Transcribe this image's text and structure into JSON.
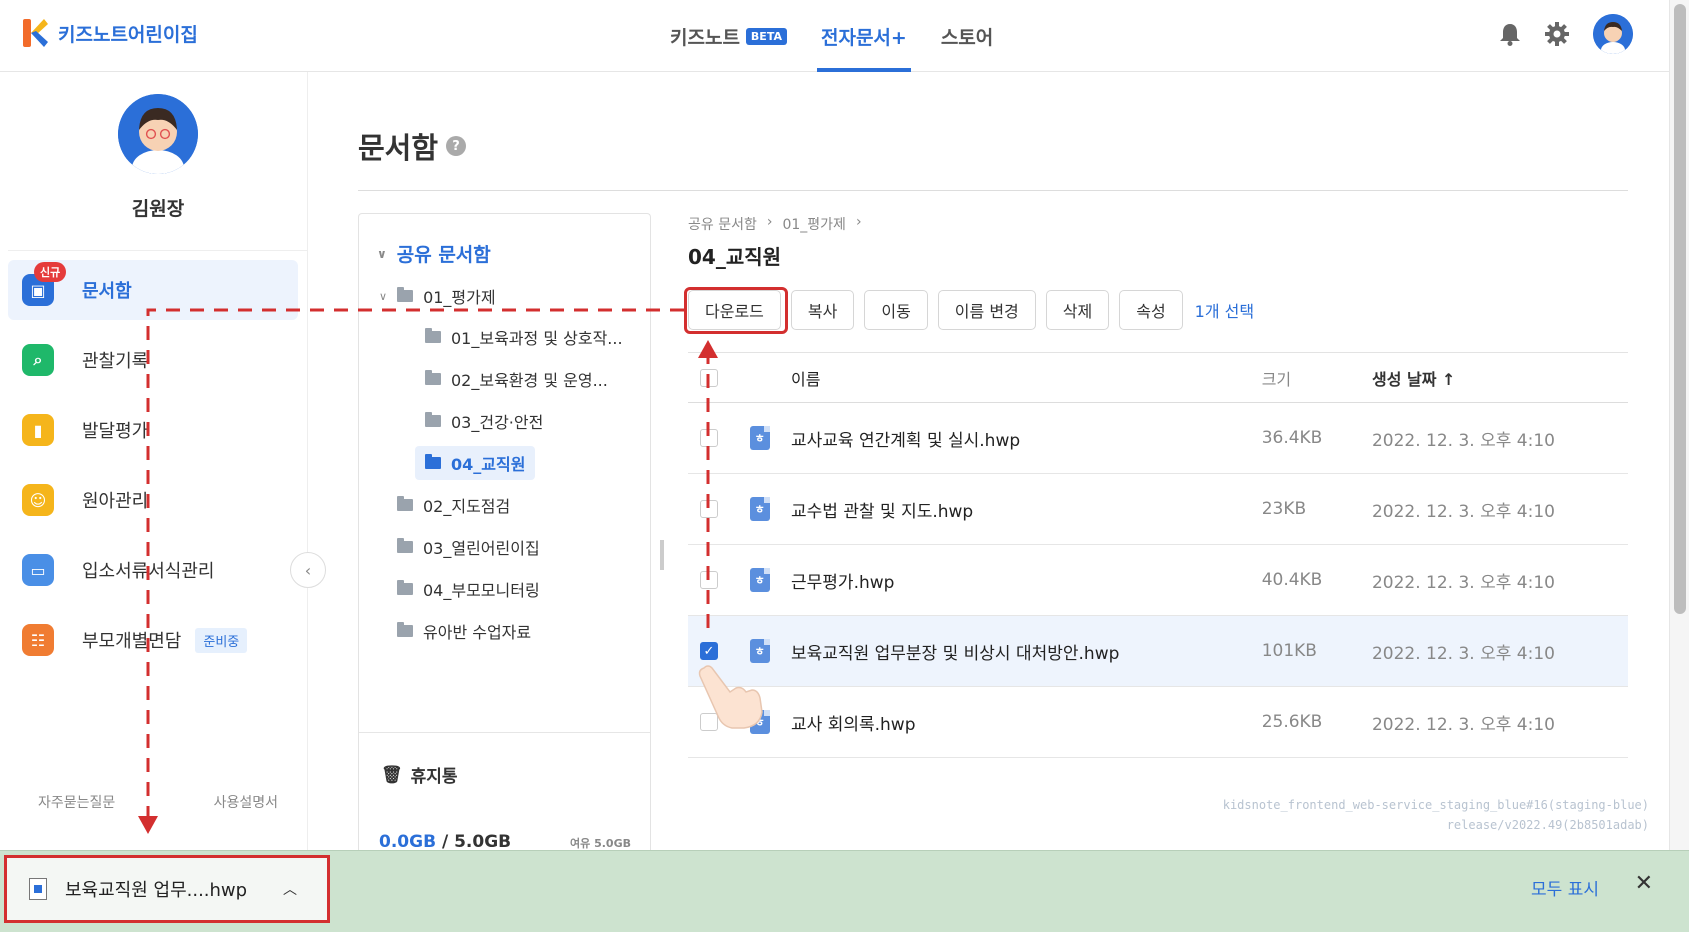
{
  "header": {
    "brand": "키즈노트어린이집",
    "nav": [
      {
        "label": "키즈노트",
        "badge": "BETA"
      },
      {
        "label": "전자문서+"
      },
      {
        "label": "스토어"
      }
    ]
  },
  "sidebar": {
    "user_name": "김원장",
    "new_badge": "신규",
    "items": [
      {
        "label": "문서함",
        "icon": "document-box-icon",
        "color": "#2b6fd8"
      },
      {
        "label": "관찰기록",
        "icon": "magnifier-icon",
        "color": "#1fb86a"
      },
      {
        "label": "발달평가",
        "icon": "bar-chart-icon",
        "color": "#f5b51b"
      },
      {
        "label": "원아관리",
        "icon": "children-icon",
        "color": "#f5b51b"
      },
      {
        "label": "입소서류서식관리",
        "icon": "form-icon",
        "color": "#4a8fe6"
      },
      {
        "label": "부모개별면담",
        "icon": "meeting-icon",
        "color": "#f07c32",
        "badge": "준비중"
      }
    ],
    "footer": {
      "faq": "자주묻는질문",
      "manual": "사용설명서"
    }
  },
  "main": {
    "title": "문서함",
    "tree": {
      "root": "공유 문서함",
      "nodes": [
        {
          "label": "01_평가제",
          "level": 1
        },
        {
          "label": "01_보육과정 및 상호작...",
          "level": 2
        },
        {
          "label": "02_보육환경 및 운영...",
          "level": 2
        },
        {
          "label": "03_건강·안전",
          "level": 2
        },
        {
          "label": "04_교직원",
          "level": 2
        },
        {
          "label": "02_지도점검",
          "level": 1
        },
        {
          "label": "03_열린어린이집",
          "level": 1
        },
        {
          "label": "04_부모모니터링",
          "level": 1
        },
        {
          "label": "유아반 수업자료",
          "level": 1
        }
      ],
      "trash": "휴지통",
      "storage_used": "0.0GB",
      "storage_total": " / 5.0GB",
      "storage_free": "여유 5.0GB"
    },
    "breadcrumb": [
      "공유 문서함",
      "01_평가제"
    ],
    "folder_title": "04_교직원",
    "toolbar": {
      "download": "다운로드",
      "copy": "복사",
      "move": "이동",
      "rename": "이름 변경",
      "delete": "삭제",
      "properties": "속성",
      "selection": "1개 선택"
    },
    "columns": {
      "name": "이름",
      "size": "크기",
      "date": "생성 날짜 ↑"
    },
    "files": [
      {
        "name": "교사교육 연간계획 및 실시.hwp",
        "size": "36.4KB",
        "date": "2022. 12. 3. 오후 4:10",
        "checked": false
      },
      {
        "name": "교수법 관찰 및 지도.hwp",
        "size": "23KB",
        "date": "2022. 12. 3. 오후 4:10",
        "checked": false
      },
      {
        "name": "근무평가.hwp",
        "size": "40.4KB",
        "date": "2022. 12. 3. 오후 4:10",
        "checked": false
      },
      {
        "name": "보육교직원 업무분장 및 비상시 대처방안.hwp",
        "size": "101KB",
        "date": "2022. 12. 3. 오후 4:10",
        "checked": true
      },
      {
        "name": "교사 회의록.hwp",
        "size": "25.6KB",
        "date": "2022. 12. 3. 오후 4:10",
        "checked": false
      }
    ],
    "version_line1": "kidsnote_frontend_web-service_staging_blue#16(staging-blue)",
    "version_line2": "release/v2022.49(2b8501adab)"
  },
  "download_bar": {
    "file": "보육교직원 업무....hwp",
    "show_all": "모두 표시",
    "close": "✕"
  }
}
